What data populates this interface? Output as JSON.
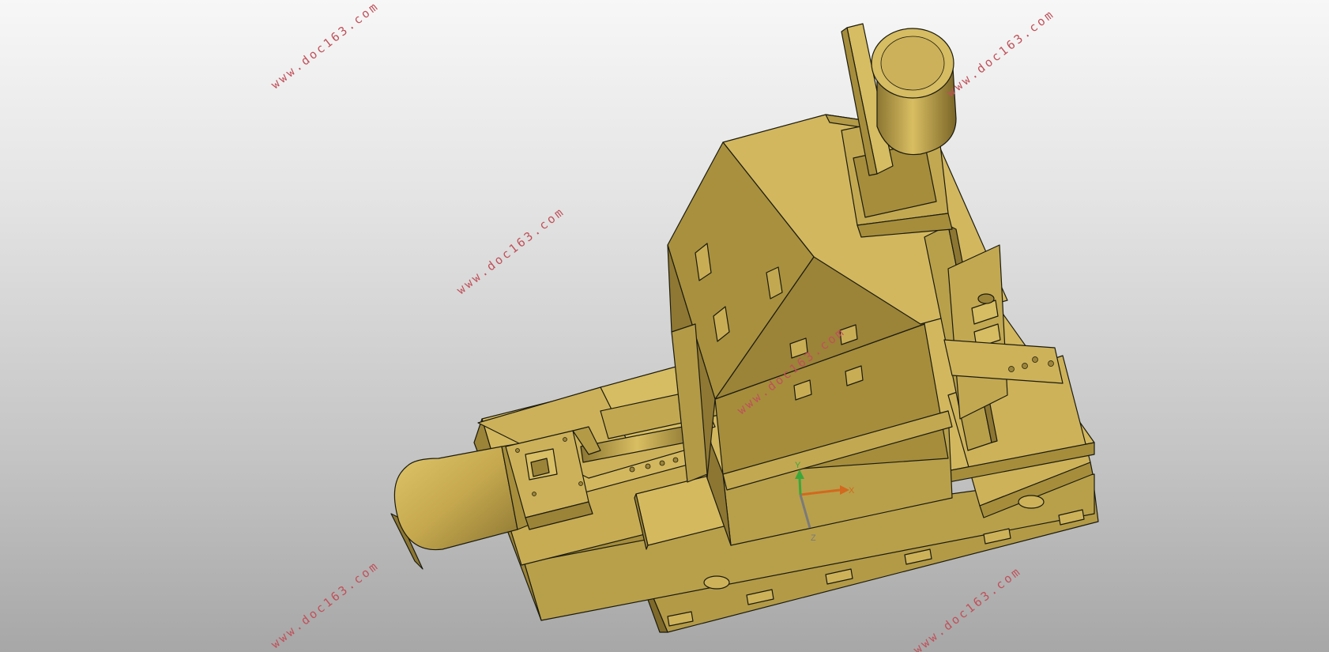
{
  "viewport": {
    "view": "3D part model (isometric)",
    "colors": {
      "body": "#c9ad55",
      "body_light": "#d6bc62",
      "body_dark": "#9b8338",
      "body_shadow": "#7f6a2a",
      "edge": "#1b1b10",
      "watermark": "#c0505a"
    }
  },
  "watermarks": [
    "www.doc163.com",
    "www.doc163.com",
    "www.doc163.com",
    "www.doc163.com",
    "www.doc163.com",
    "www.doc163.com",
    "www.doc163.com"
  ],
  "triad": {
    "x_label": "X",
    "y_label": "Y",
    "z_label": "Z"
  }
}
